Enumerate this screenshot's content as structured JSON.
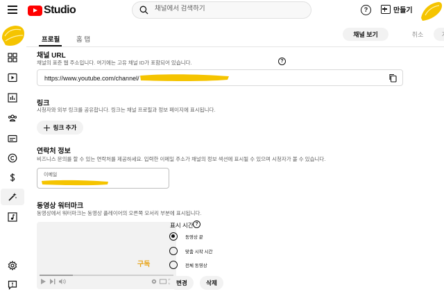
{
  "header": {
    "logo_text": "Studio",
    "search_placeholder": "채널에서 검색하기",
    "create_label": "만들기",
    "help_glyph": "?"
  },
  "tabs": [
    {
      "label": "프로필",
      "active": true
    },
    {
      "label": "홈 탭",
      "active": false
    }
  ],
  "actions": {
    "view_channel": "채널 보기",
    "cancel": "취소",
    "publish": "게시"
  },
  "channel_url": {
    "title": "채널 URL",
    "description": "채널의 표준 웹 주소입니다. 여기에는 고유 채널 ID가 포함되어 있습니다.",
    "url_prefix": "https://www.youtube.com/channel/"
  },
  "links": {
    "title": "링크",
    "description": "시청자와 외부 링크를 공유합니다. 링크는 채널 프로필과 정보 페이지에 표시됩니다.",
    "add_button": "링크 추가"
  },
  "contact": {
    "title": "연락처 정보",
    "description": "비즈니스 문의를 할 수 있는 연락처를 제공하세요. 입력한 이메일 주소가 채널의 정보 섹션에 표시될 수 있으며 시청자가 볼 수 있습니다.",
    "email_label": "이메일"
  },
  "watermark": {
    "title": "동영상 워터마크",
    "description": "동영상에서 워터마크는 동영상 플레이어의 오른쪽 모서리 부분에 표시됩니다.",
    "preview_text": "구독",
    "display_time_label": "표시 시간",
    "options": [
      {
        "label": "동영상 끝",
        "checked": true
      },
      {
        "label": "맞춤 시작 시간",
        "checked": false
      },
      {
        "label": "전체 동영상",
        "checked": false
      }
    ],
    "change_button": "변경",
    "remove_button": "삭제"
  },
  "colors": {
    "brand_red": "#ff0000",
    "redaction": "#f5c400",
    "watermark_text": "#e8a317"
  }
}
